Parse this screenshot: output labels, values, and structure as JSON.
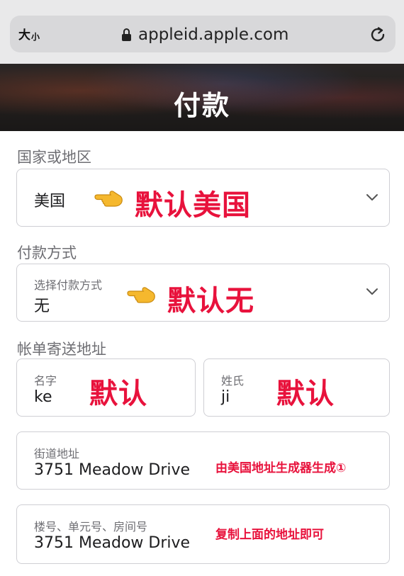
{
  "browser": {
    "text_size_label_large": "大",
    "text_size_label_small": "小",
    "url": "appleid.apple.com",
    "lock_icon": "lock-icon",
    "reload_icon": "reload-icon"
  },
  "page": {
    "title": "付款"
  },
  "country": {
    "section_label": "国家或地区",
    "value": "美国",
    "annotation": "默认美国"
  },
  "payment": {
    "section_label": "付款方式",
    "caption": "选择付款方式",
    "value": "无",
    "annotation": "默认无"
  },
  "billing": {
    "section_label": "帐单寄送地址",
    "first_name_caption": "名字",
    "first_name_value": "ke",
    "first_name_annotation": "默认",
    "last_name_caption": "姓氏",
    "last_name_value": "ji",
    "last_name_annotation": "默认",
    "street_caption": "街道地址",
    "street_value": "3751  Meadow Drive",
    "street_annotation": "由美国地址生成器生成①",
    "unit_caption": "楼号、单元号、房间号",
    "unit_value": "3751  Meadow Drive",
    "unit_annotation": "复制上面的地址即可"
  },
  "colors": {
    "annotation_red": "#e8123c",
    "hand_yellow": "#f5b82e"
  }
}
